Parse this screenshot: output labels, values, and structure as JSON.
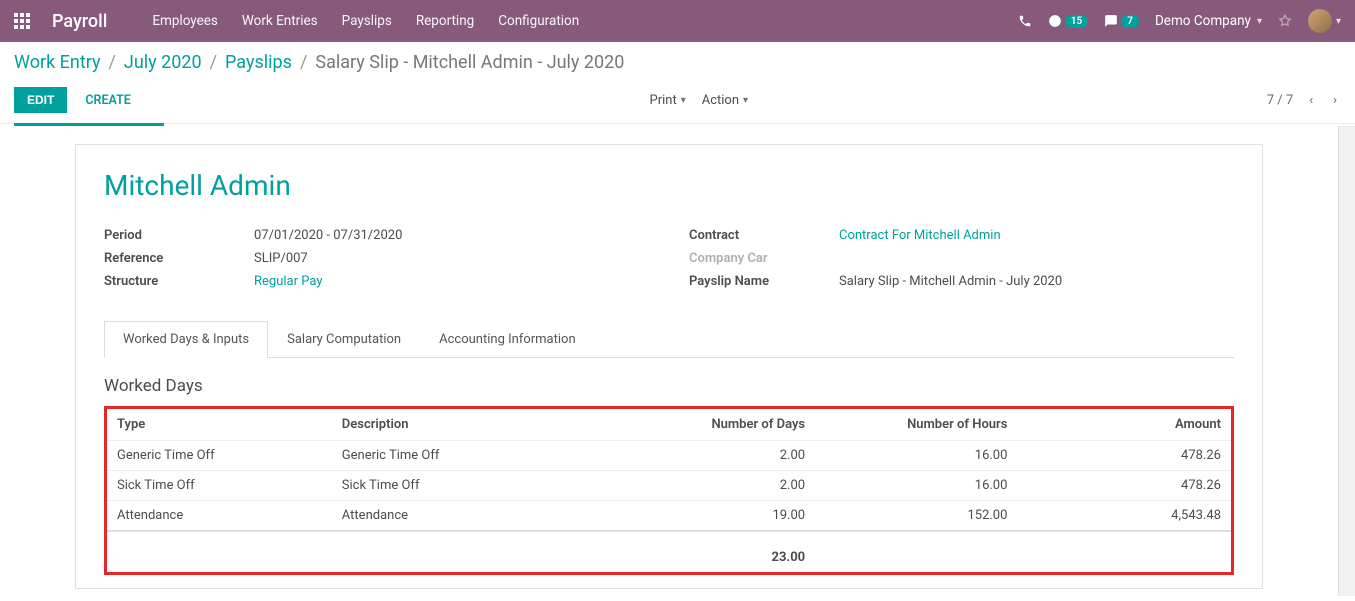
{
  "nav": {
    "app_title": "Payroll",
    "items": [
      "Employees",
      "Work Entries",
      "Payslips",
      "Reporting",
      "Configuration"
    ],
    "wip_badge": "15",
    "chat_badge": "7",
    "company": "Demo Company"
  },
  "breadcrumb": {
    "parts": [
      "Work Entry",
      "July 2020",
      "Payslips"
    ],
    "current": "Salary Slip - Mitchell Admin - July 2020"
  },
  "controls": {
    "edit": "Edit",
    "create": "Create",
    "print": "Print",
    "action": "Action",
    "pager": "7 / 7"
  },
  "record": {
    "employee": "Mitchell Admin",
    "left": {
      "period_label": "Period",
      "period_value": "07/01/2020 - 07/31/2020",
      "reference_label": "Reference",
      "reference_value": "SLIP/007",
      "structure_label": "Structure",
      "structure_value": "Regular Pay"
    },
    "right": {
      "contract_label": "Contract",
      "contract_value": "Contract For Mitchell Admin",
      "car_label": "Company Car",
      "car_value": "",
      "name_label": "Payslip Name",
      "name_value": "Salary Slip - Mitchell Admin - July 2020"
    }
  },
  "tabs": [
    "Worked Days & Inputs",
    "Salary Computation",
    "Accounting Information"
  ],
  "section": {
    "title": "Worked Days",
    "headers": {
      "type": "Type",
      "description": "Description",
      "days": "Number of Days",
      "hours": "Number of Hours",
      "amount": "Amount"
    },
    "rows": [
      {
        "type": "Generic Time Off",
        "description": "Generic Time Off",
        "days": "2.00",
        "hours": "16.00",
        "amount": "478.26"
      },
      {
        "type": "Sick Time Off",
        "description": "Sick Time Off",
        "days": "2.00",
        "hours": "16.00",
        "amount": "478.26"
      },
      {
        "type": "Attendance",
        "description": "Attendance",
        "days": "19.00",
        "hours": "152.00",
        "amount": "4,543.48"
      }
    ],
    "total_days": "23.00"
  }
}
